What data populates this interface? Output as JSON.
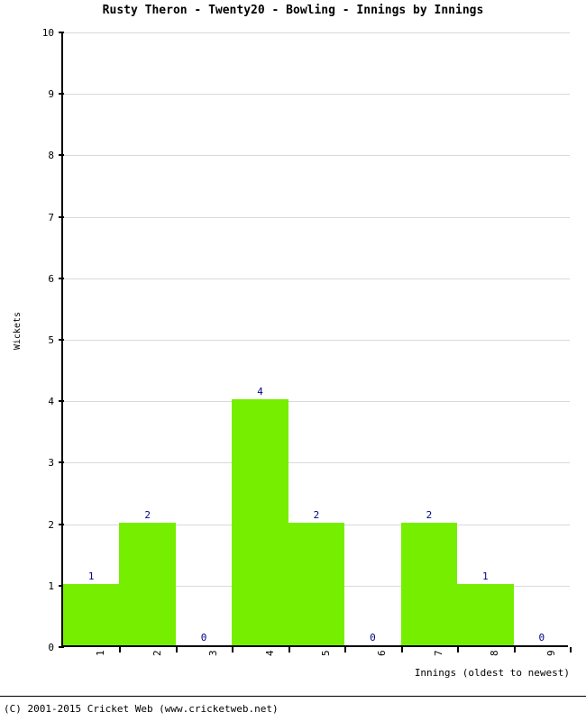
{
  "chart_data": {
    "type": "bar",
    "title": "Rusty Theron - Twenty20 - Bowling - Innings by Innings",
    "xlabel": "Innings (oldest to newest)",
    "ylabel": "Wickets",
    "categories": [
      "1",
      "2",
      "3",
      "4",
      "5",
      "6",
      "7",
      "8",
      "9"
    ],
    "values": [
      1,
      2,
      0,
      4,
      2,
      0,
      2,
      1,
      0
    ],
    "value_labels": [
      "1",
      "2",
      "0",
      "4",
      "2",
      "0",
      "2",
      "1",
      "0"
    ],
    "ylim": [
      0,
      10
    ],
    "yticks": [
      "0",
      "1",
      "2",
      "3",
      "4",
      "5",
      "6",
      "7",
      "8",
      "9",
      "10"
    ],
    "grid": true,
    "legend": false,
    "bar_color": "#76ee00",
    "value_label_color": "#00008b",
    "axis_color": "#000000",
    "grid_color": "#d9d9d9",
    "background_color": "#ffffff"
  },
  "footer": {
    "copyright": "(C) 2001-2015 Cricket Web (www.cricketweb.net)"
  }
}
